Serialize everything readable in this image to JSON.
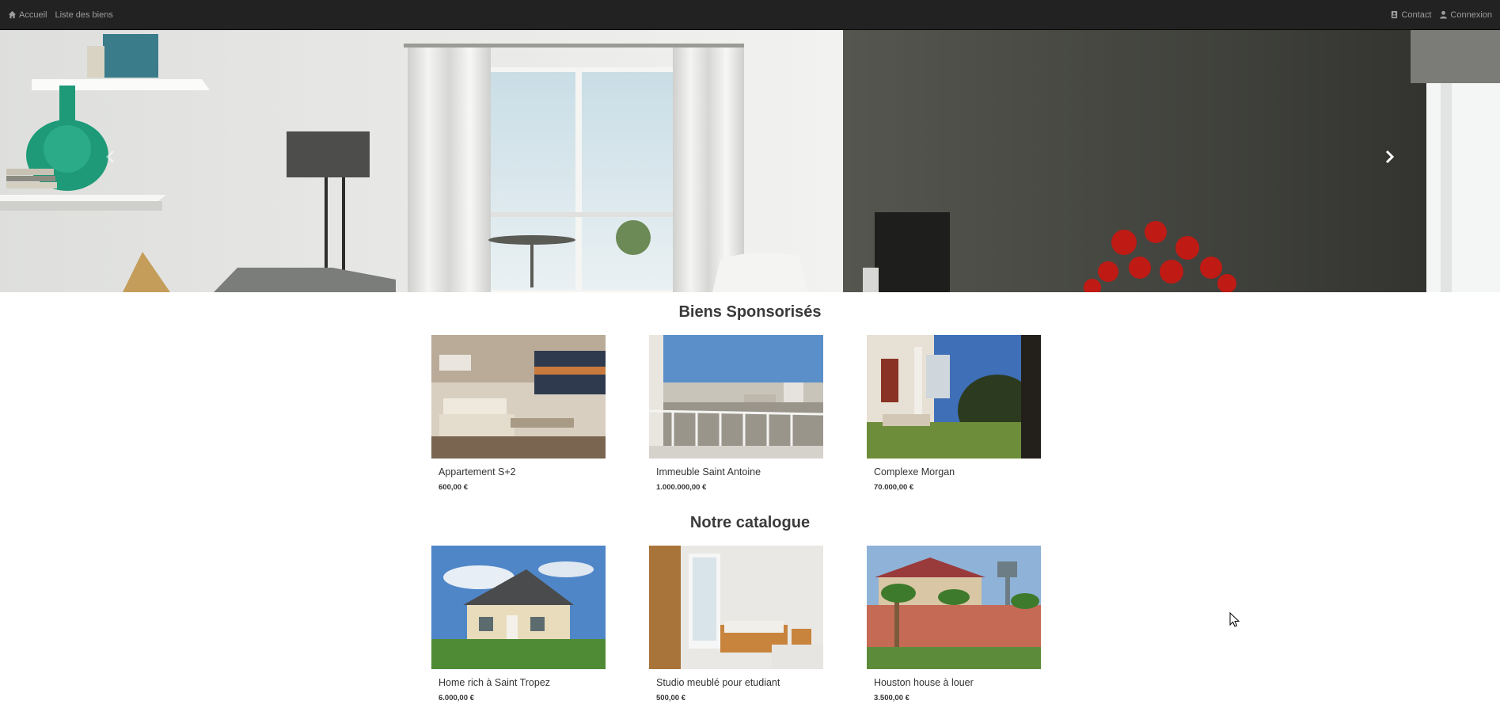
{
  "nav": {
    "home_label": "Accueil",
    "list_label": "Liste des biens",
    "contact_label": "Contact",
    "login_label": "Connexion"
  },
  "hero": {
    "prev_icon": "chevron-left-icon",
    "next_icon": "chevron-right-icon"
  },
  "sponsored": {
    "title": "Biens Sponsorisés",
    "items": [
      {
        "name": "Appartement S+2",
        "price": "600,00 €"
      },
      {
        "name": "Immeuble Saint Antoine",
        "price": "1.000.000,00 €"
      },
      {
        "name": "Complexe Morgan",
        "price": "70.000,00 €"
      }
    ]
  },
  "catalogue": {
    "title": "Notre catalogue",
    "items": [
      {
        "name": "Home rich à Saint Tropez",
        "price": "6.000,00 €"
      },
      {
        "name": "Studio meublé pour etudiant",
        "price": "500,00 €"
      },
      {
        "name": "Houston house à louer",
        "price": "3.500,00 €"
      }
    ]
  },
  "colors": {
    "navbar_bg": "#222222",
    "nav_text": "#9d9d9d"
  }
}
